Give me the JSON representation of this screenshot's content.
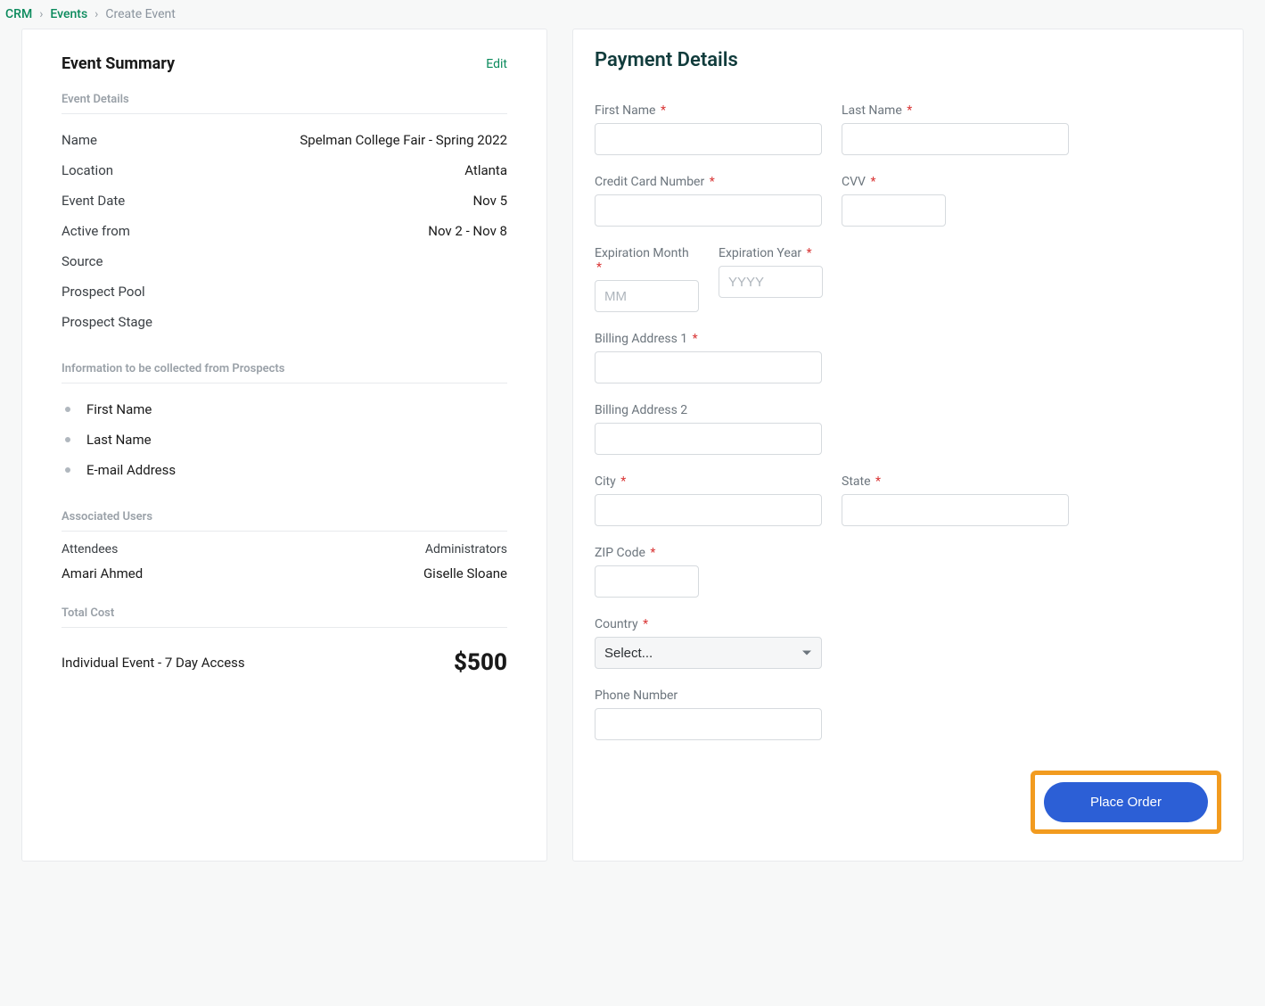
{
  "breadcrumb": {
    "crm": "CRM",
    "events": "Events",
    "current": "Create Event"
  },
  "summary": {
    "title": "Event Summary",
    "edit": "Edit",
    "details_label": "Event Details",
    "rows": [
      {
        "key": "Name",
        "val": "Spelman College Fair - Spring 2022"
      },
      {
        "key": "Location",
        "val": "Atlanta"
      },
      {
        "key": "Event Date",
        "val": "Nov 5"
      },
      {
        "key": "Active from",
        "val": "Nov 2 - Nov 8"
      },
      {
        "key": "Source",
        "val": ""
      },
      {
        "key": "Prospect Pool",
        "val": ""
      },
      {
        "key": "Prospect Stage",
        "val": ""
      }
    ],
    "prospect_info_label": "Information to be collected from Prospects",
    "prospect_fields": [
      "First Name",
      "Last Name",
      "E-mail Address"
    ],
    "assoc_label": "Associated Users",
    "attendees_head": "Attendees",
    "attendees_val": "Amari Ahmed",
    "admins_head": "Administrators",
    "admins_val": "Giselle Sloane",
    "cost_label": "Total Cost",
    "cost_line": "Individual Event - 7 Day Access",
    "cost_value": "$500"
  },
  "payment": {
    "title": "Payment Details",
    "first_name": "First Name",
    "last_name": "Last Name",
    "cc_num": "Credit Card Number",
    "cvv": "CVV",
    "exp_month": "Expiration Month",
    "exp_month_ph": "MM",
    "exp_year": "Expiration Year",
    "exp_year_ph": "YYYY",
    "addr1": "Billing Address 1",
    "addr2": "Billing Address 2",
    "city": "City",
    "state": "State",
    "zip": "ZIP Code",
    "country": "Country",
    "country_select": "Select...",
    "phone": "Phone Number",
    "place_order": "Place Order"
  }
}
